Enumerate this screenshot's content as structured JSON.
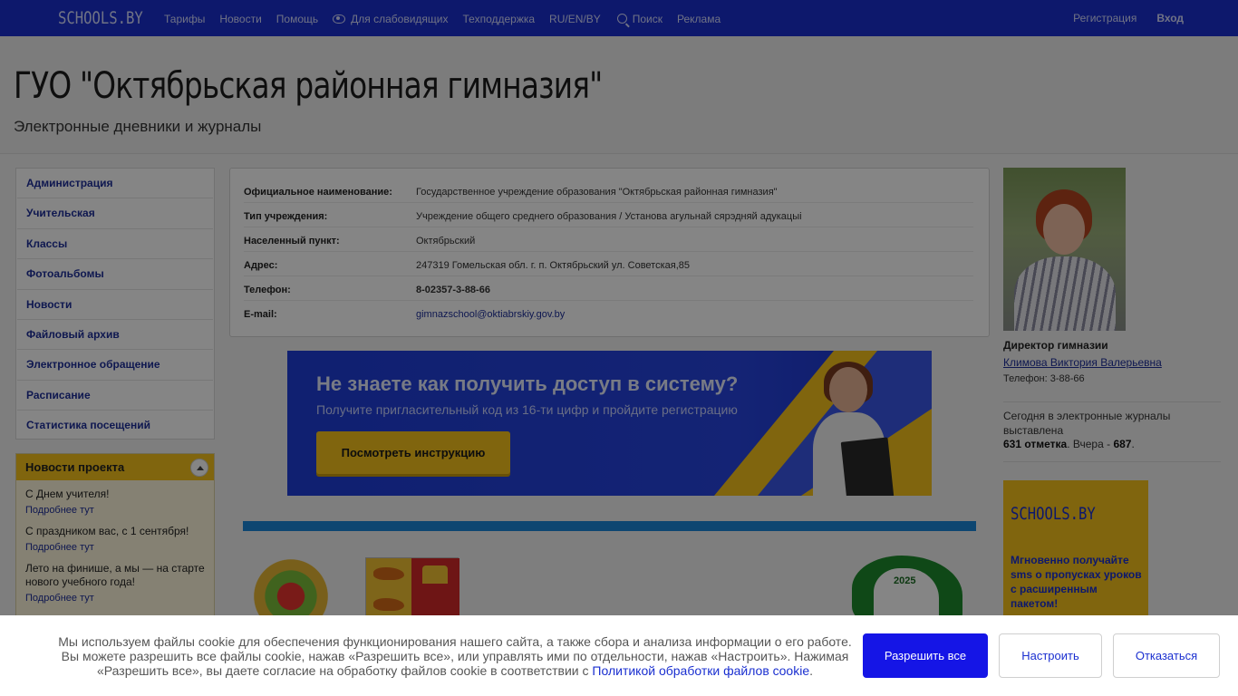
{
  "topbar": {
    "logo": "SCHOOLS.BY",
    "nav": [
      "Тарифы",
      "Новости",
      "Помощь",
      "Для слабовидящих",
      "Техподдержка",
      "RU/EN/BY",
      "Поиск",
      "Реклама"
    ],
    "register": "Регистрация",
    "login": "Вход"
  },
  "header": {
    "title": "ГУО \"Октябрьская районная гимназия\"",
    "subtitle": "Электронные дневники и журналы"
  },
  "sidebar": {
    "items": [
      "Администрация",
      "Учительская",
      "Классы",
      "Фотоальбомы",
      "Новости",
      "Файловый архив",
      "Электронное обращение",
      "Расписание",
      "Статистика посещений"
    ]
  },
  "news": {
    "title": "Новости проекта",
    "items": [
      {
        "text": "С Днем учителя!",
        "link": "Подробнее тут"
      },
      {
        "text": "С праздником вас, с 1 сентября!",
        "link": "Подробнее тут"
      },
      {
        "text": "Лето на финише, а мы — на старте нового учебного года!",
        "link": "Подробнее тут"
      }
    ]
  },
  "info": {
    "rows": [
      {
        "label": "Официальное наименование:",
        "value": "Государственное учреждение образования \"Октябрьская районная гимназия\""
      },
      {
        "label": "Тип учреждения:",
        "value": "Учреждение общего среднего образования / Установа агульнай сярэдняй адукацыі"
      },
      {
        "label": "Населенный пункт:",
        "value": "Октябрьский"
      },
      {
        "label": "Адрес:",
        "value": "247319 Гомельская обл. г. п. Октябрьский ул. Советская,85"
      },
      {
        "label": "Телефон:",
        "value": "8-02357-3-88-66"
      },
      {
        "label": "E-mail:",
        "value": "gimnazschool@oktiabrskiy.gov.by"
      }
    ]
  },
  "banner": {
    "title": "Не знаете как получить доступ в систему?",
    "subtitle": "Получите пригласительный код из 16-ти цифр и пройдите регистрацию",
    "button": "Посмотреть инструкцию"
  },
  "emblem": {
    "year": "2025"
  },
  "director": {
    "title": "Директор гимназии",
    "name": "Климова Виктория Валерьевна",
    "phone": "Телефон: 3-88-66"
  },
  "stats": {
    "line1": "Сегодня в электронные журналы выставлена",
    "today": "631 отметка",
    "yesterday_label": ". Вчера - ",
    "yesterday": "687",
    "end": "."
  },
  "ad": {
    "logo": "SCHOOLS.BY",
    "text": "Мгновенно получайте sms о пропусках уроков с расширенным пакетом!"
  },
  "cookie": {
    "text": "Мы используем файлы cookie для обеспечения функционирования нашего сайта, а также сбора и анализа информации о его работе. Вы можете разрешить все файлы cookie, нажав «Разрешить все», или управлять ими по отдельности, нажав «Настроить». Нажимая «Разрешить все», вы даете согласие на обработку файлов cookie в соответствии с ",
    "link": "Политикой обработки файлов cookie",
    "end": ".",
    "allow": "Разрешить все",
    "configure": "Настроить",
    "decline": "Отказаться"
  },
  "colors": {
    "navbar": "#1a2fd0",
    "accent_yellow": "#f5c21b",
    "link": "#1e2f9a",
    "cookie_primary": "#1515e6"
  }
}
